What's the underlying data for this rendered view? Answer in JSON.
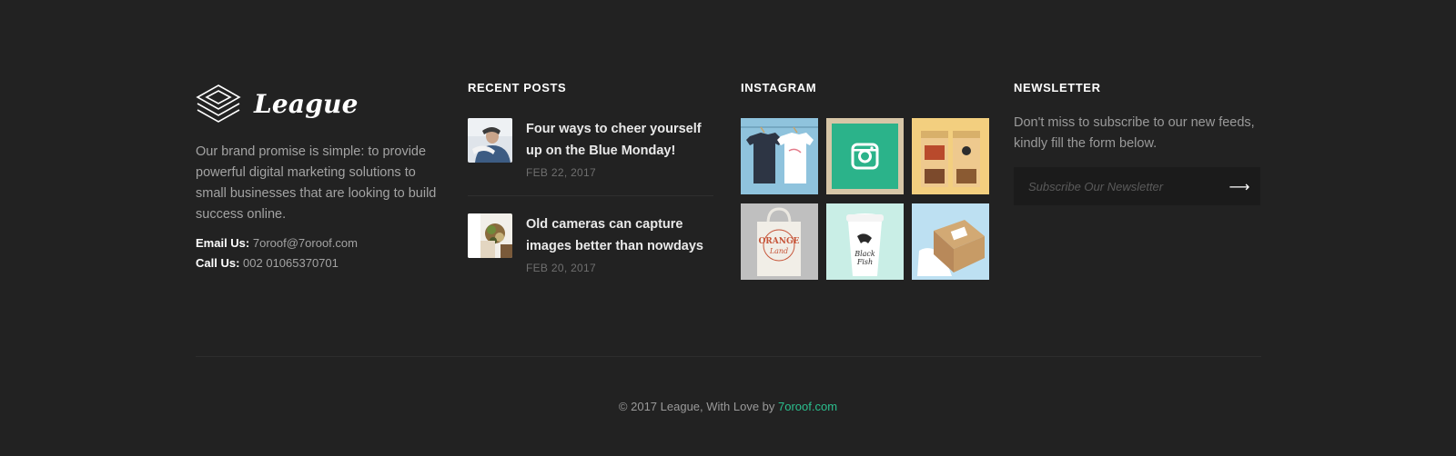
{
  "brand": {
    "name": "League",
    "description": "Our brand promise is simple: to provide powerful digital marketing solutions to small businesses that are looking to build success online."
  },
  "contact": {
    "email_label": "Email Us:",
    "email_value": "7oroof@7oroof.com",
    "phone_label": "Call Us:",
    "phone_value": "002 01065370701"
  },
  "recent_posts": {
    "title": "RECENT POSTS",
    "items": [
      {
        "title": "Four ways to cheer yourself up on the Blue Monday!",
        "date": "FEB 22, 2017"
      },
      {
        "title": "Old cameras can capture images better than nowdays",
        "date": "FEB 20, 2017"
      }
    ]
  },
  "instagram": {
    "title": "INSTAGRAM",
    "items": [
      "t-shirts",
      "instagram-logo",
      "coffee-bags",
      "tote-bag",
      "coffee-cup",
      "gift-box"
    ]
  },
  "newsletter": {
    "title": "NEWSLETTER",
    "text": "Don't miss to subscribe to our new feeds, kindly fill the form below.",
    "placeholder": "Subscribe Our Newsletter",
    "submit_icon": "arrow-right-icon"
  },
  "footer": {
    "copyright_prefix": "© 2017 League, With Love by ",
    "copyright_link": "7oroof.com"
  },
  "colors": {
    "background": "#222222",
    "accent": "#2bbf8e",
    "input_bg": "#1b1b1b"
  }
}
